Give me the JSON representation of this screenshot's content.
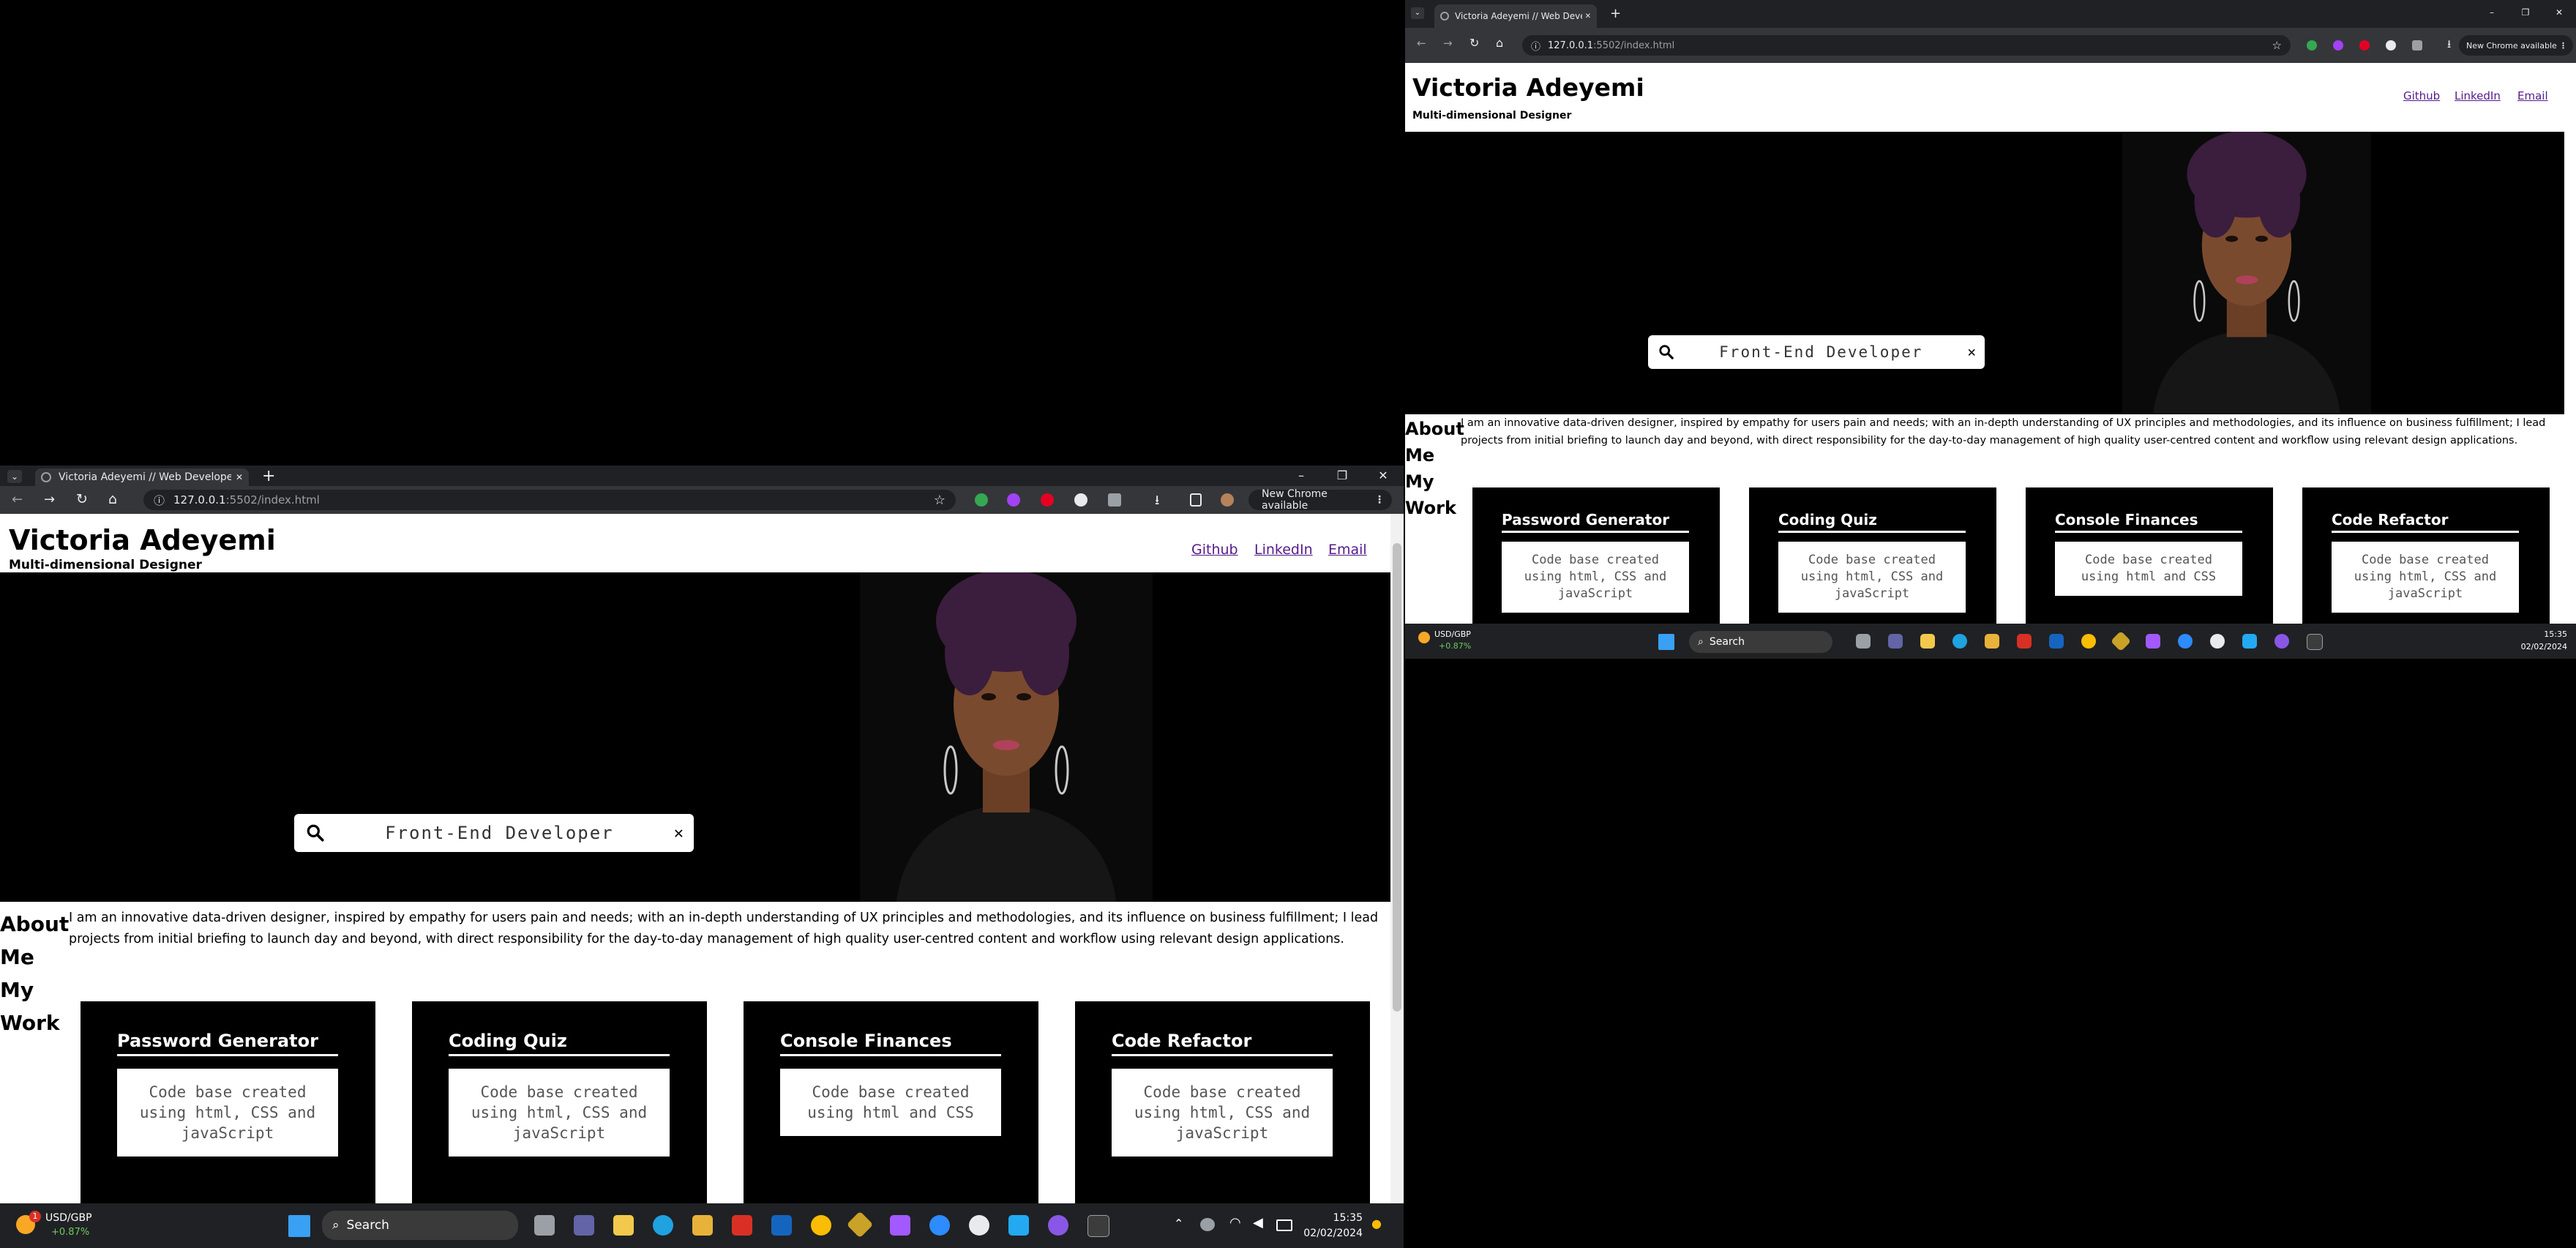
{
  "browser": {
    "tab_title": "Victoria Adeyemi // Web Developer",
    "new_tab": "+",
    "url_host": "127.0.0.1",
    "url_path": ":5502/index.html",
    "new_chrome": "New Chrome available",
    "window_controls": {
      "minimize": "–",
      "restore": "❐",
      "close": "✕"
    }
  },
  "site": {
    "name": "Victoria Adeyemi",
    "role": "Multi-dimensional Designer",
    "nav": [
      "Github",
      "LinkedIn",
      "Email"
    ],
    "search_text": "Front-End Developer",
    "about_label": "About Me",
    "work_label": "My Work",
    "about_text": "I am an innovative data-driven designer, inspired by empathy for users pain and needs; with an in-depth understanding of UX principles and methodologies, and its influence on business fulfillment; I lead projects from initial briefing to launch day and beyond, with direct responsibility for the day-to-day management of high quality user-centred content and workflow using relevant design applications.",
    "projects": [
      {
        "title": "Password Generator",
        "desc": "Code base created using html, CSS and javaScript"
      },
      {
        "title": "Coding Quiz",
        "desc": "Code base created using html, CSS and javaScript"
      },
      {
        "title": "Console Finances",
        "desc": "Code base created using html and CSS"
      },
      {
        "title": "Code Refactor",
        "desc": "Code base created using html, CSS and javaScript"
      }
    ]
  },
  "taskbar": {
    "ticker_name": "USD/GBP",
    "ticker_change": "+0.87%",
    "ticker_badge": "1",
    "search_label": "Search",
    "time": "15:35",
    "date": "02/02/2024"
  },
  "colors": {
    "link": "#551a8b",
    "chrome_dark": "#202124",
    "chrome_toolbar": "#35363a",
    "ticker_green": "#6ccb5f"
  }
}
